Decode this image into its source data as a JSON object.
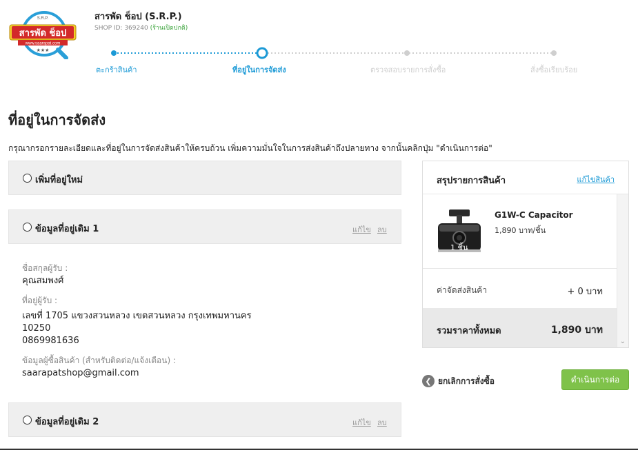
{
  "shop": {
    "logo_top": "S.R.P.",
    "logo_main": "สารพัด ช็อป",
    "logo_url": "www.saarapat.com",
    "logo_stars": "★★★",
    "name": "สารพัด ช็อป (S.R.P.)",
    "id_text": "SHOP ID: 369240",
    "status": "(ร้านเปิดปกติ)"
  },
  "steps": [
    {
      "label": "ตะกร้าสินค้า",
      "state": "done"
    },
    {
      "label": "ที่อยู่ในการจัดส่ง",
      "state": "current"
    },
    {
      "label": "ตรวจสอบรายการสั่งซื้อ",
      "state": "todo"
    },
    {
      "label": "สั่งซื้อเรียบร้อย",
      "state": "todo"
    }
  ],
  "page": {
    "title": "ที่อยู่ในการจัดส่ง",
    "description": "กรุณากรอกรายละเอียดและที่อยู่ในการจัดส่งสินค้าให้ครบถ้วน เพิ่มความมั่นใจในการส่งสินค้าถึงปลายทาง จากนั้นคลิกปุ่ม \"ดำเนินการต่อ\""
  },
  "address_panels": {
    "new": {
      "title": "เพิ่มที่อยู่ใหม่"
    },
    "saved1": {
      "title": "ข้อมูลที่อยู่เดิม 1",
      "edit": "แก้ไข",
      "delete": "ลบ"
    },
    "saved2": {
      "title": "ข้อมูลที่อยู่เดิม 2",
      "edit": "แก้ไข",
      "delete": "ลบ"
    }
  },
  "address_detail": {
    "recipient_label": "ชื่อสกุลผู้รับ :",
    "recipient_value": "คุณสมพงศ์",
    "address_label": "ที่อยู่ผู้รับ :",
    "address_line": "เลขที่ 1705 แขวงสวนหลวง เขตสวนหลวง กรุงเทพมหานคร",
    "postcode": "10250",
    "phone": "0869981636",
    "buyer_label": "ข้อมูลผู้ซื้อสินค้า (สำหรับติดต่อ/แจ้งเตือน) :",
    "buyer_email": "saarapatshop@gmail.com"
  },
  "summary": {
    "title": "สรุปรายการสินค้า",
    "edit": "แก้ไขสินค้า",
    "product_name": "G1W-C Capacitor",
    "product_price": "1,890 บาท/ชิ้น",
    "product_qty": "1 ชิ้น",
    "shipping_label": "ค่าจัดส่งสินค้า",
    "shipping_value": "+ 0 บาท",
    "total_label": "รวมราคาทั้งหมด",
    "total_value": "1,890 บาท"
  },
  "actions": {
    "cancel": "ยกเลิกการสั่งซื้อ",
    "continue": "ดำเนินการต่อ"
  },
  "colors": {
    "accent": "#1c9ad6",
    "continue_button": "#7fc24a",
    "logo_red": "#d32a2a",
    "logo_yellow": "#f3d12a",
    "panel_bg": "#efefef"
  }
}
